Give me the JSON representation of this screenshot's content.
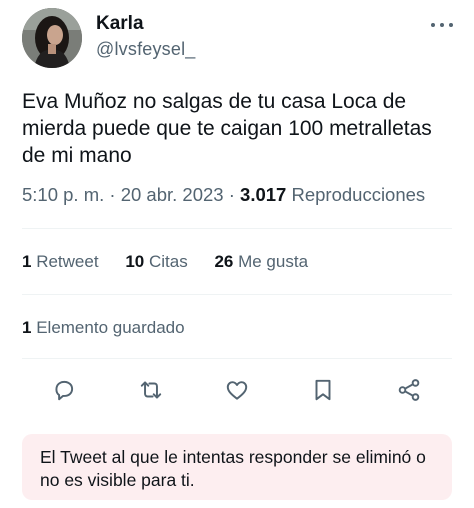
{
  "author": {
    "display_name": "Karla",
    "handle": "@lvsfeysel_"
  },
  "tweet": {
    "text": "Eva Muñoz no salgas de tu casa Loca de mierda puede que te caigan 100 metralletas de mi mano",
    "time": "5:10 p. m.",
    "date": "20 abr. 2023",
    "views_count": "3.017",
    "views_label": "Reproducciones",
    "separator": "·"
  },
  "stats": {
    "retweets_count": "1",
    "retweets_label": "Retweet",
    "quotes_count": "10",
    "quotes_label": "Citas",
    "likes_count": "26",
    "likes_label": "Me gusta",
    "bookmarks_count": "1",
    "bookmarks_label": "Elemento guardado"
  },
  "actions": {
    "icons": [
      "reply-icon",
      "retweet-icon",
      "like-icon",
      "bookmark-icon",
      "share-icon"
    ],
    "icon_color": "#536471"
  },
  "notice": {
    "text": "El Tweet al que le intentas responder se eliminó o no es visible para ti.",
    "background": "#fdeef0"
  }
}
